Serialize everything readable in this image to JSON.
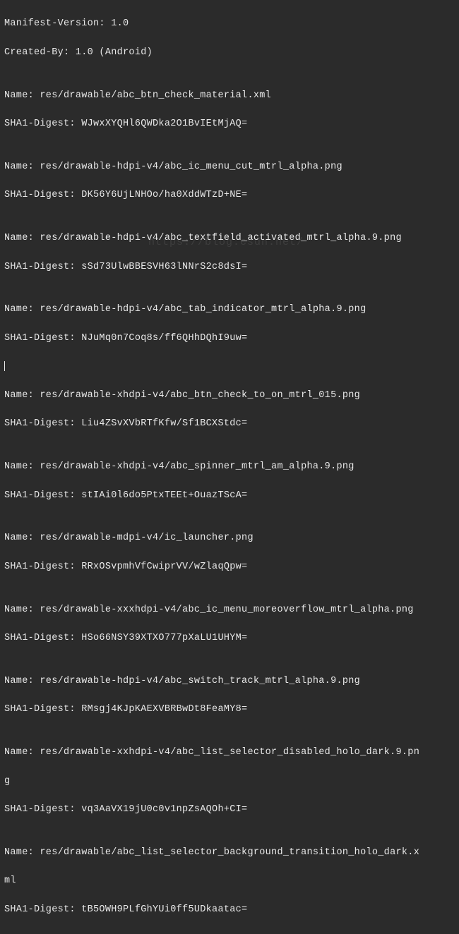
{
  "header": [
    "Manifest-Version: 1.0",
    "Created-By: 1.0 (Android)"
  ],
  "entries": [
    {
      "name": "Name: res/drawable/abc_btn_check_material.xml",
      "digest": "SHA1-Digest: WJwxXYQHl6QWDka2O1BvIEtMjAQ="
    },
    {
      "name": "Name: res/drawable-hdpi-v4/abc_ic_menu_cut_mtrl_alpha.png",
      "digest": "SHA1-Digest: DK56Y6UjLNHOo/ha0XddWTzD+NE="
    },
    {
      "name": "Name: res/drawable-hdpi-v4/abc_textfield_activated_mtrl_alpha.9.png",
      "digest": "SHA1-Digest: sSd73UlwBBESVH63lNNrS2c8dsI="
    },
    {
      "name": "Name: res/drawable-hdpi-v4/abc_tab_indicator_mtrl_alpha.9.png",
      "digest": "SHA1-Digest: NJuMq0n7Coq8s/ff6QHhDQhI9uw=",
      "hasCursor": true
    },
    {
      "name": "Name: res/drawable-xhdpi-v4/abc_btn_check_to_on_mtrl_015.png",
      "digest": "SHA1-Digest: Liu4ZSvXVbRTfKfw/Sf1BCXStdc="
    },
    {
      "name": "Name: res/drawable-xhdpi-v4/abc_spinner_mtrl_am_alpha.9.png",
      "digest": "SHA1-Digest: stIAi0l6do5PtxTEEt+OuazTScA="
    },
    {
      "name": "Name: res/drawable-mdpi-v4/ic_launcher.png",
      "digest": "SHA1-Digest: RRxOSvpmhVfCwiprVV/wZlaqQpw="
    },
    {
      "name": "Name: res/drawable-xxxhdpi-v4/abc_ic_menu_moreoverflow_mtrl_alpha.png",
      "digest": "SHA1-Digest: HSo66NSY39XTXO777pXaLU1UHYM="
    },
    {
      "name": "Name: res/drawable-hdpi-v4/abc_switch_track_mtrl_alpha.9.png",
      "digest": "SHA1-Digest: RMsgj4KJpKAEXVBRBwDt8FeaMY8="
    },
    {
      "name": "Name: res/drawable-xxhdpi-v4/abc_list_selector_disabled_holo_dark.9.pn",
      "nameCont": "g",
      "digest": "SHA1-Digest: vq3AaVX19jU0c0v1npZsAQOh+CI="
    },
    {
      "name": "Name: res/drawable/abc_list_selector_background_transition_holo_dark.x",
      "nameCont": "ml",
      "digest": "SHA1-Digest: tB5OWH9PLfGhYUi0ff5UDkaatac="
    }
  ],
  "watermark": "https://blog.csdn.net/"
}
